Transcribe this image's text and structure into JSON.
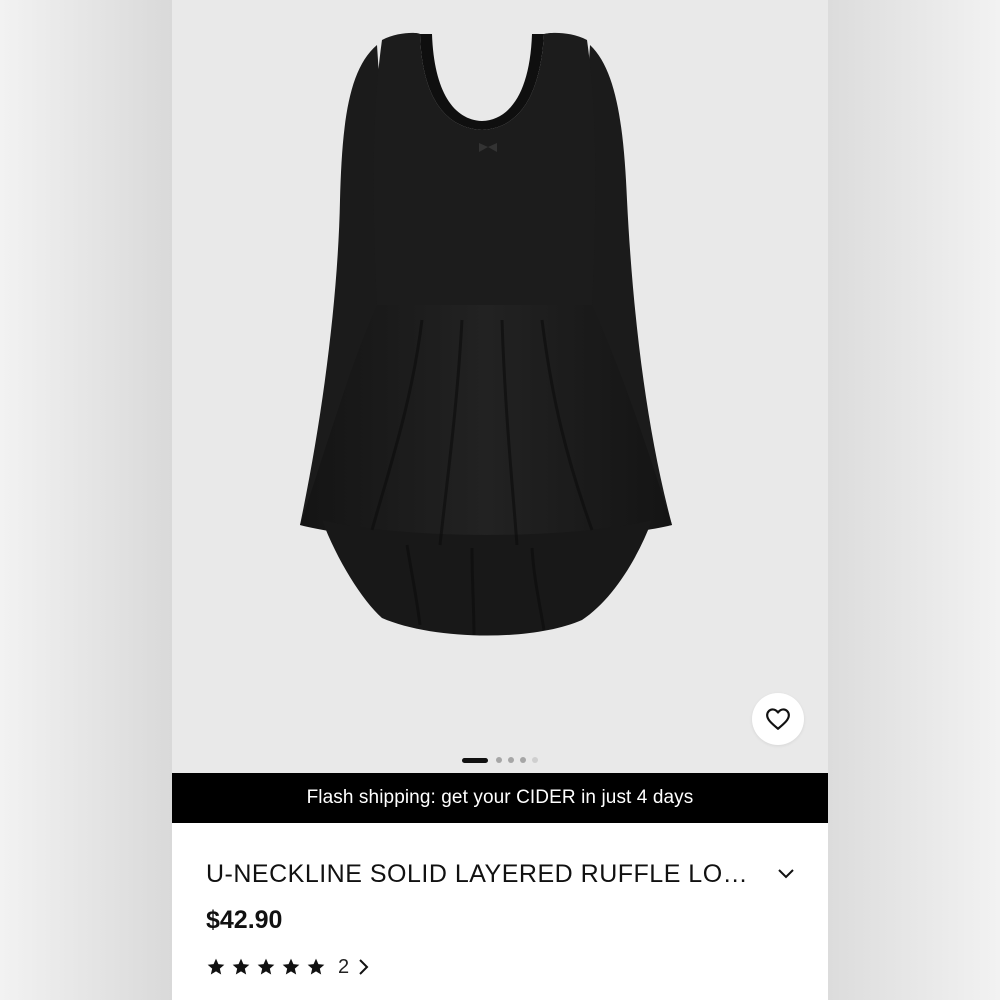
{
  "product": {
    "title": "U-NECKLINE SOLID LAYERED RUFFLE LO…",
    "price": "$42.90",
    "rating": {
      "stars": 5,
      "review_count": "2"
    },
    "image_alt": "black long sleeve layered ruffle mini dress"
  },
  "banner": {
    "text": "Flash shipping: get your CIDER in just 4 days"
  },
  "carousel": {
    "total": 5,
    "active_index": 0
  },
  "icons": {
    "wishlist": "heart-icon",
    "expand": "chevron-down-icon",
    "reviews": "chevron-right-icon",
    "star": "star-icon"
  },
  "colors": {
    "banner_bg": "#000000",
    "banner_text": "#ffffff",
    "image_bg": "#e9e9e9",
    "dress": "#1a1a1a"
  }
}
